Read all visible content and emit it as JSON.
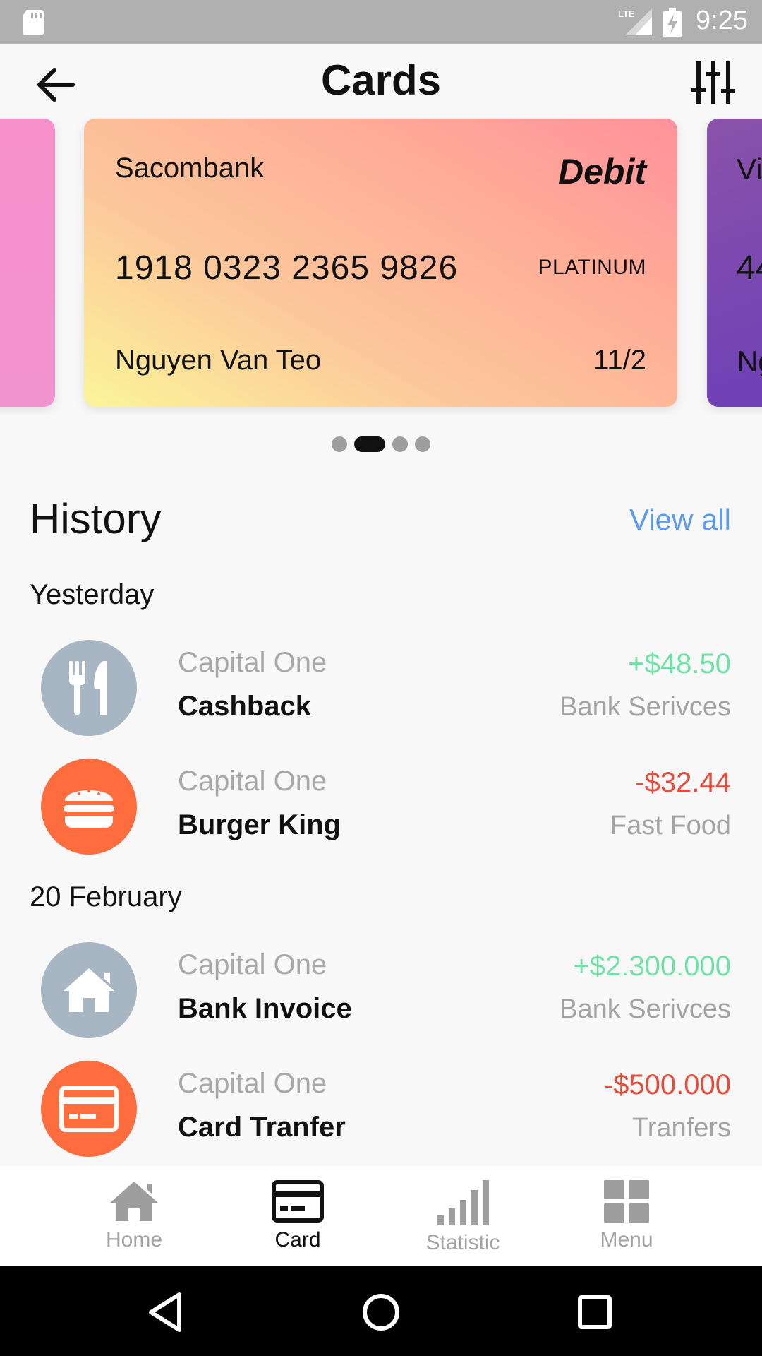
{
  "status_bar": {
    "time": "9:25",
    "network": "LTE",
    "icons": [
      "sd-card-icon",
      "lte-signal-icon",
      "battery-charging-icon"
    ]
  },
  "header": {
    "title": "Cards",
    "back_icon": "arrow-left-icon",
    "filter_icon": "sliders-icon"
  },
  "cards": {
    "main": {
      "bank": "Sacombank",
      "type": "Debit",
      "number": "1918 0323 2365 9826",
      "tier": "PLATINUM",
      "holder": "Nguyen Van Teo",
      "expiry": "11/2"
    },
    "next_peek": {
      "bank": "Vi",
      "number": "44",
      "holder": "Ng"
    },
    "pager": {
      "count": 4,
      "active_index": 1
    }
  },
  "history": {
    "title": "History",
    "view_all": "View all",
    "groups": [
      {
        "label": "Yesterday",
        "items": [
          {
            "bank": "Capital One",
            "name": "Cashback",
            "amount": "+$48.50",
            "category": "Bank Serivces",
            "icon": "cutlery-icon",
            "sign": "positive"
          },
          {
            "bank": "Capital One",
            "name": "Burger King",
            "amount": "-$32.44",
            "category": "Fast Food",
            "icon": "burger-icon",
            "sign": "negative"
          }
        ]
      },
      {
        "label": "20 February",
        "items": [
          {
            "bank": "Capital One",
            "name": "Bank Invoice",
            "amount": "+$2.300.000",
            "category": "Bank Serivces",
            "icon": "home-icon",
            "sign": "positive"
          },
          {
            "bank": "Capital One",
            "name": "Card Tranfer",
            "amount": "-$500.000",
            "category": "Tranfers",
            "icon": "credit-card-icon",
            "sign": "negative"
          }
        ]
      }
    ]
  },
  "bottom_nav": {
    "items": [
      {
        "label": "Home",
        "icon": "home-icon",
        "active": false
      },
      {
        "label": "Card",
        "icon": "credit-card-icon",
        "active": true
      },
      {
        "label": "Statistic",
        "icon": "bar-chart-icon",
        "active": false
      },
      {
        "label": "Menu",
        "icon": "grid-icon",
        "active": false
      }
    ]
  },
  "colors": {
    "positive": "#6fe3a6",
    "negative": "#e84b3a",
    "link": "#5b9bf0",
    "avatar_gray": "#a7b6c2",
    "avatar_orange": "#ff6d3f"
  }
}
